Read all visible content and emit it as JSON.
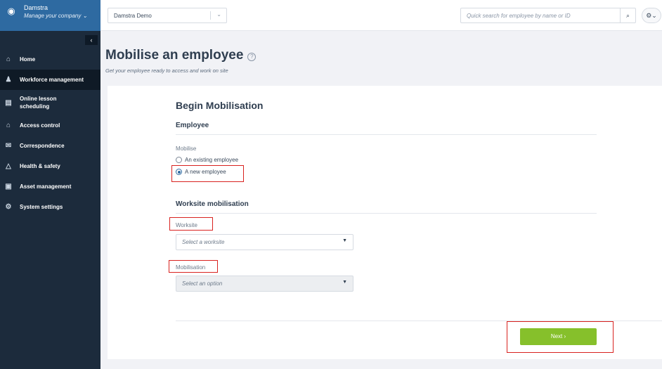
{
  "sidebar": {
    "brand_name": "Damstra",
    "brand_sub": "Manage your company ⌄",
    "collapse_glyph": "‹",
    "items": [
      {
        "icon": "home-icon",
        "glyph": "⌂",
        "label": "Home"
      },
      {
        "icon": "person-icon",
        "glyph": "♟",
        "label": "Workforce management",
        "active": true
      },
      {
        "icon": "calendar-icon",
        "glyph": "▤",
        "label": "Online lesson scheduling"
      },
      {
        "icon": "building-icon",
        "glyph": "⌂",
        "label": "Access control"
      },
      {
        "icon": "chat-icon",
        "glyph": "✉",
        "label": "Correspondence"
      },
      {
        "icon": "warning-icon",
        "glyph": "△",
        "label": "Health & safety"
      },
      {
        "icon": "truck-icon",
        "glyph": "▣",
        "label": "Asset management"
      },
      {
        "icon": "gears-icon",
        "glyph": "⚙",
        "label": "System settings"
      }
    ]
  },
  "topbar": {
    "company": "Damstra Demo",
    "search_placeholder": "Quick search for employee by name or ID",
    "search_glyph": "⌕",
    "gear_glyph": "⚙⌄"
  },
  "page": {
    "title": "Mobilise an employee",
    "help_glyph": "?",
    "subtitle": "Get your employee ready to access and work on site"
  },
  "form": {
    "section_title": "Begin Mobilisation",
    "employee_title": "Employee",
    "mobilise_label": "Mobilise",
    "options": [
      {
        "label": "An existing employee",
        "checked": false
      },
      {
        "label": "A new employee",
        "checked": true
      }
    ],
    "worksite_section_title": "Worksite mobilisation",
    "worksite_label": "Worksite",
    "worksite_placeholder": "Select a worksite",
    "mobilisation_label": "Mobilisation",
    "mobilisation_placeholder": "Select an option",
    "caret_glyph": "▼",
    "next_label": "Next ›"
  },
  "colors": {
    "sidebar_bg": "#1c2b3c",
    "brand_bg": "#2e6aa1",
    "next_button": "#86c02b",
    "highlight_box": "#d9221f"
  }
}
